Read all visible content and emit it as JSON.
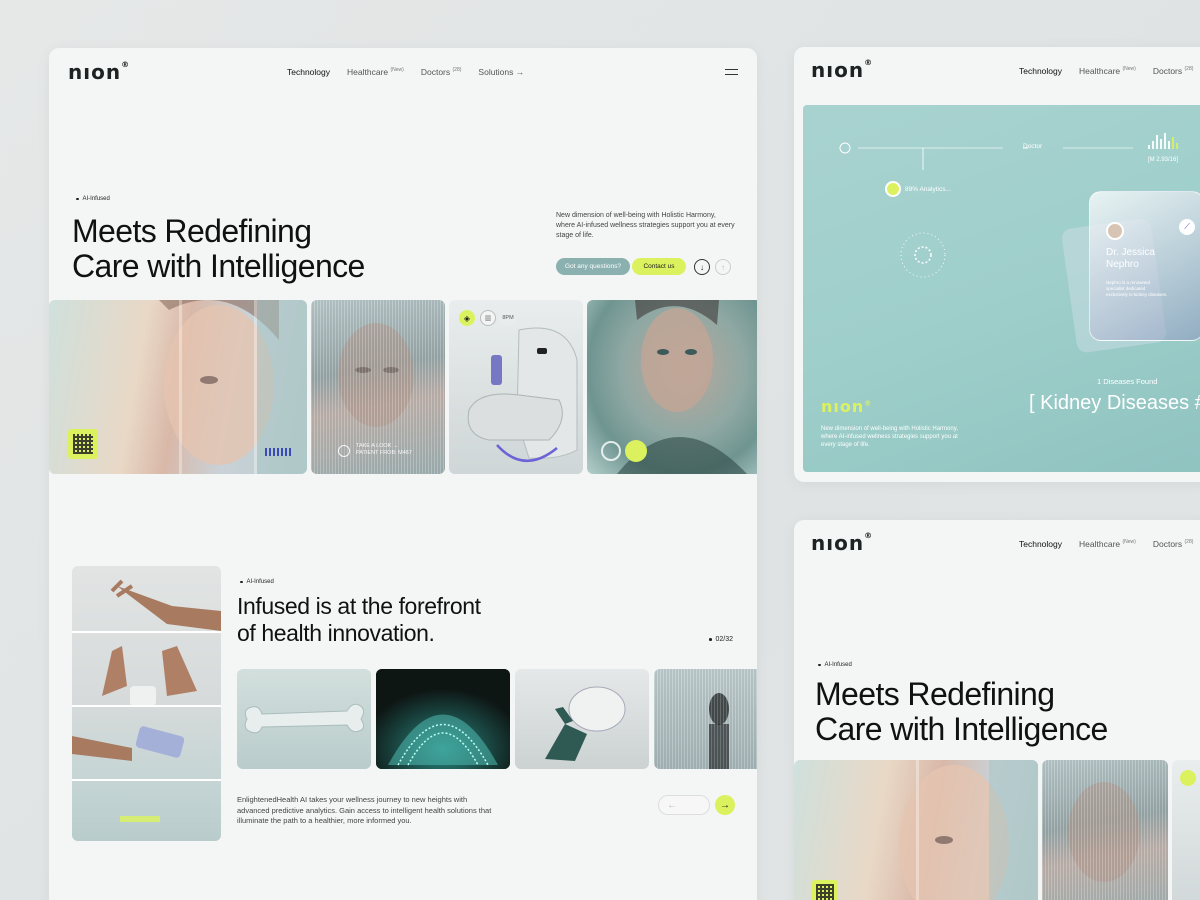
{
  "brand": {
    "logo": "nıon",
    "reg": "®"
  },
  "nav": {
    "technology": "Technology",
    "healthcare": "Healthcare",
    "healthcare_badge": "(New)",
    "doctors": "Doctors",
    "doctors_badge": "(28)",
    "solutions": "Solutions →"
  },
  "hero": {
    "tag": "AI-Infused",
    "title": "Meets Redefining\nCare with Intelligence",
    "description": "New dimension of well-being with Holistic Harmony, where AI-infused wellness strategies support you at every stage of life.",
    "btn_questions": "Got any questions?",
    "btn_contact": "Contact us"
  },
  "gallery": {
    "card2_caption": "TAKE A LOOK →\nPATIENT FROB: M467",
    "card3_icon_label": "8PM"
  },
  "section2": {
    "tag": "AI-Infused",
    "title": "Infused is at the forefront\nof health innovation.",
    "counter": "02/32",
    "body": "EnlightenedHealth AI takes your wellness journey to new heights with advanced predictive analytics. Gain access to intelligent health solutions that illuminate the path to a healthier, more informed you."
  },
  "dashboard": {
    "doctor_label": "Doctor",
    "reading": "[M 2.93/16]",
    "analytics": "89% Analytics...",
    "doctor_name": "Dr. Jessica\nNephro",
    "doctor_desc": "Nephro is a renowned specialist dedicated exclusively to kidney diseases.",
    "found_label": "1 Diseases Found",
    "disease": "[ Kidney Diseases #",
    "teal_desc": "New dimension of well-being with Holistic Harmony, where AI-infused wellness strategies support you at every stage of life."
  },
  "colors": {
    "lime": "#dbf25e",
    "teal": "#9fcfcb",
    "panel": "#f4f5f5"
  }
}
